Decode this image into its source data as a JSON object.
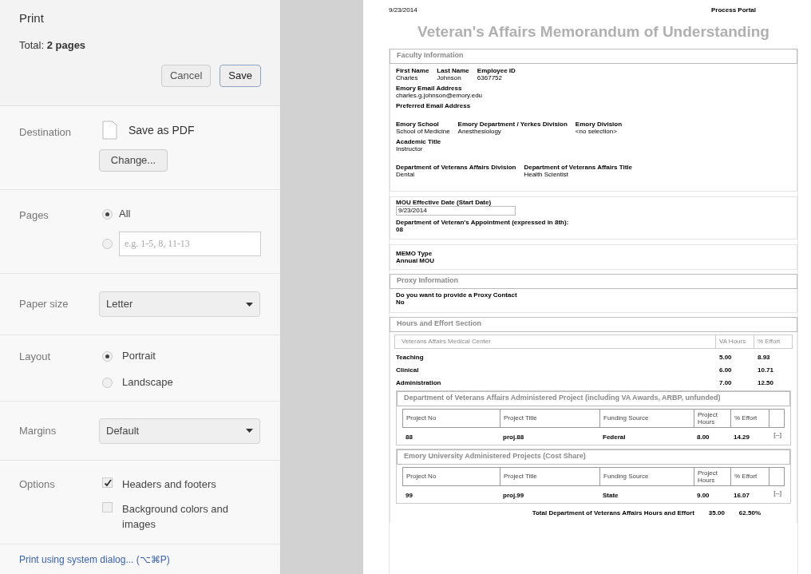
{
  "dialog": {
    "title": "Print",
    "total": "Total: **2 pages**"
  },
  "buttons": [
    {
      "label": "Cancel",
      "kind": "default"
    },
    {
      "label": "Save",
      "kind": "primary"
    }
  ],
  "destination": {
    "label": "Destination",
    "printer": "Save as PDF",
    "change_button": "Change..."
  },
  "pages": {
    "label": "Pages",
    "options": [
      {
        "kind": "all",
        "label": "All",
        "selected": true
      },
      {
        "kind": "range",
        "placeholder": "e.g. 1-5, 8, 11-13",
        "selected": false
      }
    ]
  },
  "paper_size": {
    "label": "Paper size",
    "value": "Letter"
  },
  "layout": {
    "label": "Layout",
    "options": [
      {
        "label": "Portrait",
        "selected": true
      },
      {
        "label": "Landscape",
        "selected": false
      }
    ]
  },
  "margins": {
    "label": "Margins",
    "value": "Default"
  },
  "options": {
    "label": "Options",
    "items": [
      {
        "label": "Headers and footers",
        "checked": true
      },
      {
        "label": "Background colors and images",
        "checked": false
      }
    ]
  },
  "system_dialog_link": "Print using system dialog... (⌥⌘P)",
  "preview": {
    "date": "9/23/2014",
    "site": "Process Portal",
    "title": "Veteran's Affairs Memorandum of Understanding",
    "faculty": {
      "heading": "Faculty Information",
      "rows": [
        [
          {
            "label": "First Name",
            "value": "Charles"
          },
          {
            "label": "Last Name",
            "value": "Johnson"
          },
          {
            "label": "Employee ID",
            "value": "6367752"
          }
        ],
        [
          {
            "label": "Emory Email Address",
            "value": "charles.g.johnson@emory.edu"
          }
        ],
        [
          {
            "label": "Preferred Email Address"
          }
        ],
        [
          {
            "label": "Emory School",
            "value": "School of Medicine"
          },
          {
            "label": "Emory Department / Yerkes Division",
            "value": "Anesthesiology"
          },
          {
            "label": "Emory Division",
            "value": "<no selection>"
          }
        ],
        [
          {
            "label": "Academic Title",
            "value": "Instructor"
          }
        ],
        [
          {
            "label": "Department of Veterans Affairs Division",
            "value": "Dental"
          },
          {
            "label": "Department of Veterans Affairs Title",
            "value": "Health Scientist"
          }
        ]
      ]
    },
    "mou": {
      "date_label": "MOU Effective Date (Start Date)",
      "date_value": "9/23/2014",
      "appointment_label": "Department of Veteran's Appointment (expressed in 8th):",
      "appointment_value": "08"
    },
    "memo": {
      "label": "MEMO Type",
      "value": "Annual MOU"
    },
    "proxy": {
      "heading": "Proxy Information",
      "label": "Do you want to provide a Proxy Contact",
      "value": "No"
    },
    "hours": {
      "heading": "Hours and Effort Section",
      "center": {
        "heading": "Veterans Affairs Medical Center",
        "columns": [
          "VA Hours",
          "% Effort"
        ],
        "rows": [
          {
            "name": "Teaching",
            "hours": "5.00",
            "effort": "8.93"
          },
          {
            "name": "Clinical",
            "hours": "6.00",
            "effort": "10.71"
          },
          {
            "name": "Administration",
            "hours": "7.00",
            "effort": "12.50"
          }
        ]
      },
      "projects": [
        {
          "heading": "Department of Veterans Affairs Administered Project (including VA Awards, ARBP, unfunded)",
          "columns": [
            "Project No",
            "Project Title",
            "Funding Source",
            "Project Hours",
            "% Effort"
          ],
          "rows": [
            {
              "cells": [
                "88",
                "proj.88",
                "Federal",
                "8.00",
                "14.29"
              ],
              "action": "[--]"
            }
          ]
        },
        {
          "heading": "Emory University Administered Projects (Cost Share)",
          "columns": [
            "Project No",
            "Project Title",
            "Funding Source",
            "Project Hours",
            "% Effort"
          ],
          "rows": [
            {
              "cells": [
                "99",
                "proj.99",
                "State",
                "9.00",
                "16.07"
              ],
              "action": "[--]"
            }
          ]
        }
      ],
      "total": {
        "label": "Total Department of Veterans Affairs Hours and Effort",
        "hours": "35.00",
        "effort": "62.50%"
      }
    }
  }
}
